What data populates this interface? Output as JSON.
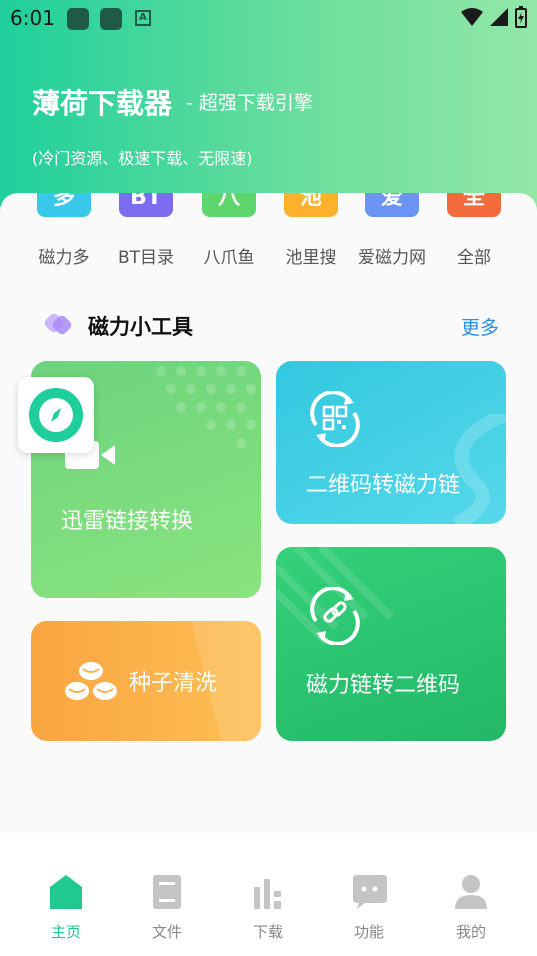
{
  "status_bar": {
    "time": "6:01",
    "a_icon_letter": "A"
  },
  "header": {
    "title": "薄荷下载器",
    "slogan": "- 超强下载引擎",
    "description": "(冷门资源、极速下载、无限速)"
  },
  "categories": [
    {
      "label": "磁力多",
      "tile_text": "多",
      "color": "#39c7ea"
    },
    {
      "label": "BT目录",
      "tile_text": "BT",
      "color": "#7b6cf0"
    },
    {
      "label": "八爪鱼",
      "tile_text": "八",
      "color": "#5fd66d"
    },
    {
      "label": "池里搜",
      "tile_text": "池",
      "color": "#fbb12c"
    },
    {
      "label": "爱磁力网",
      "tile_text": "爱",
      "color": "#6b93f3"
    },
    {
      "label": "全部",
      "tile_text": "全",
      "color": "#f36a3c"
    }
  ],
  "tools_section": {
    "title": "磁力小工具",
    "more": "更多"
  },
  "tools": {
    "xunlei": "迅雷链接转换",
    "qr_to_magnet": "二维码转磁力链",
    "seed_clean": "种子清洗",
    "magnet_to_qr": "磁力链转二维码"
  },
  "nav": [
    {
      "label": "主页",
      "icon": "home-icon",
      "active": true
    },
    {
      "label": "文件",
      "icon": "file-icon",
      "active": false
    },
    {
      "label": "下载",
      "icon": "download-bars-icon",
      "active": false
    },
    {
      "label": "功能",
      "icon": "chat-function-icon",
      "active": false
    },
    {
      "label": "我的",
      "icon": "person-icon",
      "active": false
    }
  ],
  "colors": {
    "accent": "#20c98f",
    "link": "#2a8fe6",
    "header_start": "#1fcf9b",
    "header_end": "#93e7a7"
  }
}
